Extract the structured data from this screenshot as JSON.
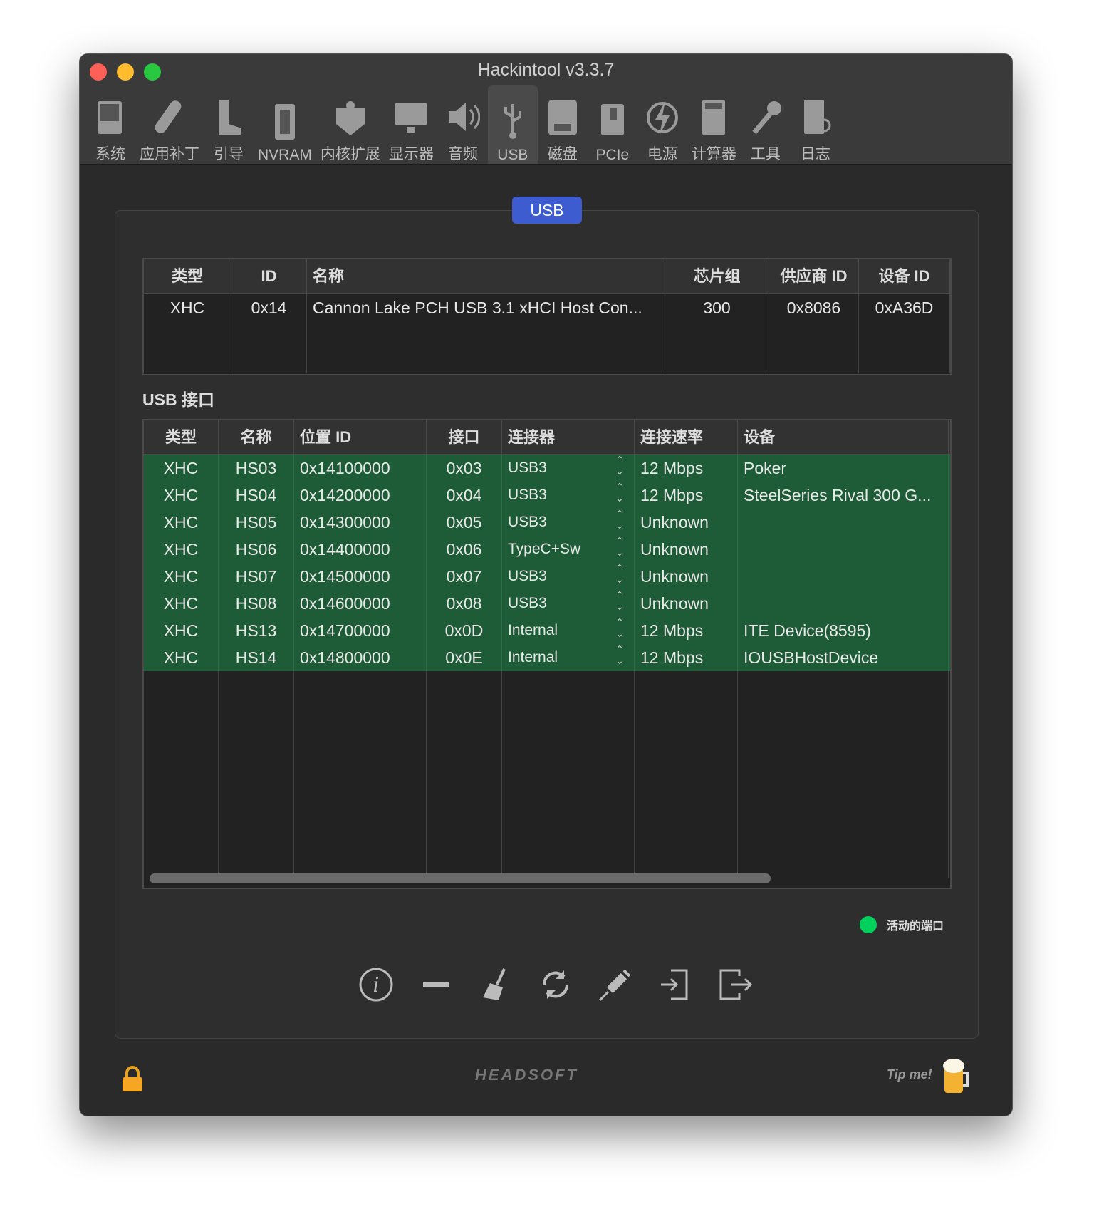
{
  "window": {
    "title": "Hackintool v3.3.7"
  },
  "toolbar": [
    {
      "label": "系统",
      "icon": "computer-icon"
    },
    {
      "label": "应用补丁",
      "icon": "bandage-icon"
    },
    {
      "label": "引导",
      "icon": "boot-icon"
    },
    {
      "label": "NVRAM",
      "icon": "memory-icon"
    },
    {
      "label": "内核扩展",
      "icon": "lego-icon"
    },
    {
      "label": "显示器",
      "icon": "display-icon"
    },
    {
      "label": "音频",
      "icon": "speaker-icon"
    },
    {
      "label": "USB",
      "icon": "usb-icon",
      "active": true
    },
    {
      "label": "磁盘",
      "icon": "disk-icon"
    },
    {
      "label": "PCIe",
      "icon": "pcie-icon"
    },
    {
      "label": "电源",
      "icon": "power-icon"
    },
    {
      "label": "计算器",
      "icon": "calculator-icon"
    },
    {
      "label": "工具",
      "icon": "wrench-icon"
    },
    {
      "label": "日志",
      "icon": "log-icon"
    }
  ],
  "segment": {
    "label": "USB"
  },
  "controllers": {
    "headers": [
      "类型",
      "ID",
      "名称",
      "芯片组",
      "供应商 ID",
      "设备 ID"
    ],
    "rows": [
      [
        "XHC",
        "0x14",
        "Cannon Lake PCH USB 3.1 xHCI Host Con...",
        "300",
        "0x8086",
        "0xA36D"
      ]
    ]
  },
  "ports": {
    "title": "USB 接口",
    "headers": [
      "类型",
      "名称",
      "位置 ID",
      "接口",
      "连接器",
      "连接速率",
      "设备"
    ],
    "rows": [
      [
        "XHC",
        "HS03",
        "0x14100000",
        "0x03",
        "USB3",
        "12 Mbps",
        "Poker"
      ],
      [
        "XHC",
        "HS04",
        "0x14200000",
        "0x04",
        "USB3",
        "12 Mbps",
        "SteelSeries Rival 300 G..."
      ],
      [
        "XHC",
        "HS05",
        "0x14300000",
        "0x05",
        "USB3",
        "Unknown",
        ""
      ],
      [
        "XHC",
        "HS06",
        "0x14400000",
        "0x06",
        "TypeC+Sw",
        "Unknown",
        ""
      ],
      [
        "XHC",
        "HS07",
        "0x14500000",
        "0x07",
        "USB3",
        "Unknown",
        ""
      ],
      [
        "XHC",
        "HS08",
        "0x14600000",
        "0x08",
        "USB3",
        "Unknown",
        ""
      ],
      [
        "XHC",
        "HS13",
        "0x14700000",
        "0x0D",
        "Internal",
        "12 Mbps",
        "ITE Device(8595)"
      ],
      [
        "XHC",
        "HS14",
        "0x14800000",
        "0x0E",
        "Internal",
        "12 Mbps",
        "IOUSBHostDevice"
      ]
    ]
  },
  "legend": {
    "label": "活动的端口",
    "color": "#00d05c"
  },
  "footer": {
    "brand": "HEADSOFT",
    "tip": "Tip me!"
  }
}
